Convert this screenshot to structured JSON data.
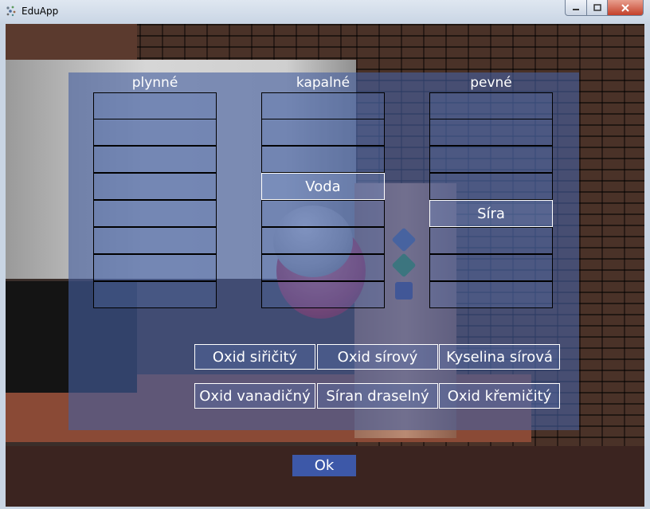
{
  "window": {
    "title": "EduApp"
  },
  "columns": [
    {
      "label": "plynné",
      "items": [
        "",
        "",
        "",
        "",
        "",
        "",
        "",
        ""
      ]
    },
    {
      "label": "kapalné",
      "items": [
        "",
        "",
        "",
        "Voda",
        "",
        "",
        "",
        ""
      ]
    },
    {
      "label": "pevné",
      "items": [
        "",
        "",
        "",
        "",
        "Síra",
        "",
        "",
        ""
      ]
    }
  ],
  "choices": [
    "Oxid siřičitý",
    "Oxid sírový",
    "Kyselina sírová",
    "Oxid vanadičný",
    "Síran draselný",
    "Oxid křemičitý"
  ],
  "ok_label": "Ok",
  "colors": {
    "overlay": "#4660a0",
    "ok_button": "#3d58a8",
    "slot_border": "#000000",
    "chip_border": "#ffffff"
  }
}
